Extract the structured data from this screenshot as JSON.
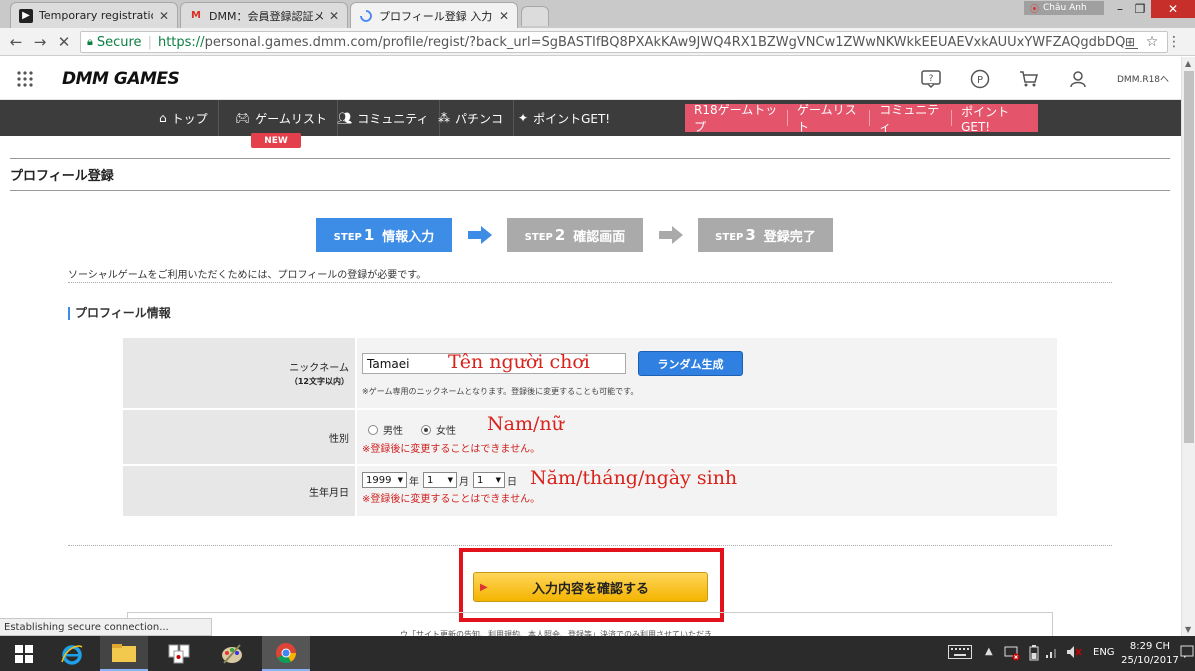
{
  "browser": {
    "tabs": [
      {
        "label": "Temporary registration c",
        "favicon": "dark-square"
      },
      {
        "label": "DMM：会員登録認証メ-",
        "favicon": "gmail-m"
      },
      {
        "label": "プロフィール登録 入力 - オン",
        "favicon": "loading-spinner"
      }
    ],
    "profile_name": "Châu Anh",
    "secure_label": "Secure",
    "url_scheme": "https://",
    "url_rest": "personal.games.dmm.com/profile/regist/?back_url=SgBASTIfBQ8PXAkKAw9JWQ4RX1BZWgVNCw1ZWwNKWkkEEUAEVxkAUUxYWFZAQgdbDQ__",
    "status_text": "Establishing secure connection..."
  },
  "header": {
    "logo": "DMM GAMES",
    "r18_link": "DMM.R18へ"
  },
  "nav": {
    "items": [
      "トップ",
      "ゲームリスト",
      "コミュニティ",
      "パチンコ",
      "ポイントGET!"
    ],
    "new_badge": "NEW",
    "r18_items": [
      "R18ゲームトップ",
      "ゲームリスト",
      "コミュニティ",
      "ポイントGET!"
    ]
  },
  "page": {
    "title": "プロフィール登録",
    "steps": [
      {
        "step": "STEP",
        "num": "1",
        "label": "情報入力",
        "active": true
      },
      {
        "step": "STEP",
        "num": "2",
        "label": "確認画面",
        "active": false
      },
      {
        "step": "STEP",
        "num": "3",
        "label": "登録完了",
        "active": false
      }
    ],
    "intro": "ソーシャルゲームをご利用いただくためには、プロフィールの登録が必要です。",
    "section_heading": "プロフィール情報"
  },
  "form": {
    "nickname_label": "ニックネーム",
    "nickname_sub": "（12文字以内）",
    "nickname_value": "Tamaei",
    "nickname_note": "※ゲーム専用のニックネームとなります。登録後に変更することも可能です。",
    "random_button": "ランダム生成",
    "gender_label": "性別",
    "gender_male": "男性",
    "gender_female": "女性",
    "gender_selected": "female",
    "gender_warning": "※登録後に変更することはできません。",
    "birth_label": "生年月日",
    "birth_year": "1999",
    "birth_year_unit": "年",
    "birth_month": "1",
    "birth_month_unit": "月",
    "birth_day": "1",
    "birth_day_unit": "日",
    "birth_warning": "※登録後に変更することはできません。",
    "confirm_button": "入力内容を確認する"
  },
  "annotations": {
    "nickname": "Tên người chơi",
    "gender": "Nam/nữ",
    "birth": "Năm/tháng/ngày sinh"
  },
  "bottom_snippet": "ウ「サイト更新の告知、利用規約、本人照会、登録等」決済でのみ利用させていただき",
  "taskbar": {
    "language": "ENG",
    "time": "8:29 CH",
    "date": "25/10/2017"
  },
  "colors": {
    "step_active": "#3d8ce6",
    "step_inactive": "#aaaaaa",
    "r18_pink": "#e4546a",
    "annotation_red": "#d8221b",
    "highlight_red": "#e3111c",
    "confirm_yellow": "#f4b400"
  }
}
